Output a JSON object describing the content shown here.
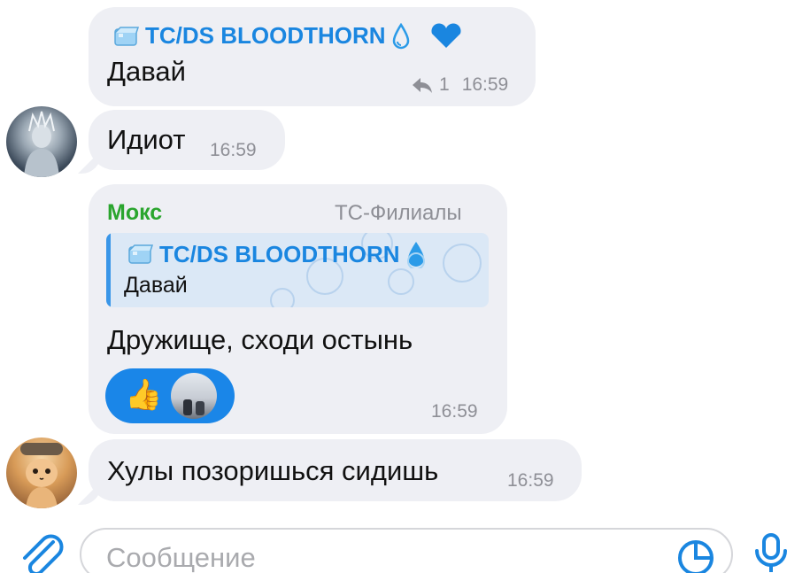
{
  "messages": [
    {
      "sender": "TC/DS BLOODTHORN",
      "text": "Давай",
      "replies_count": "1",
      "time": "16:59"
    },
    {
      "text": "Идиот",
      "time": "16:59"
    },
    {
      "sender": "Мокс",
      "sender_role": "TC-Филиалы",
      "quote": {
        "sender": "TC/DS BLOODTHORN",
        "text": "Давай"
      },
      "text": "Дружище, сходи остынь",
      "time": "16:59",
      "reaction_emoji": "👍"
    },
    {
      "text": "Хулы позоришься сидишь",
      "time": "16:59"
    }
  ],
  "composer": {
    "placeholder": "Сообщение"
  },
  "colors": {
    "bubble": "#eeeff4",
    "accent_blue": "#1a86e0",
    "sender_green": "#2aa52e",
    "time_gray": "#8e8f96"
  },
  "icons": [
    "ice-cube-icon",
    "water-drop-icon",
    "heart-icon",
    "reply-arrow-icon",
    "attach-icon",
    "sticker-icon",
    "mic-icon"
  ]
}
